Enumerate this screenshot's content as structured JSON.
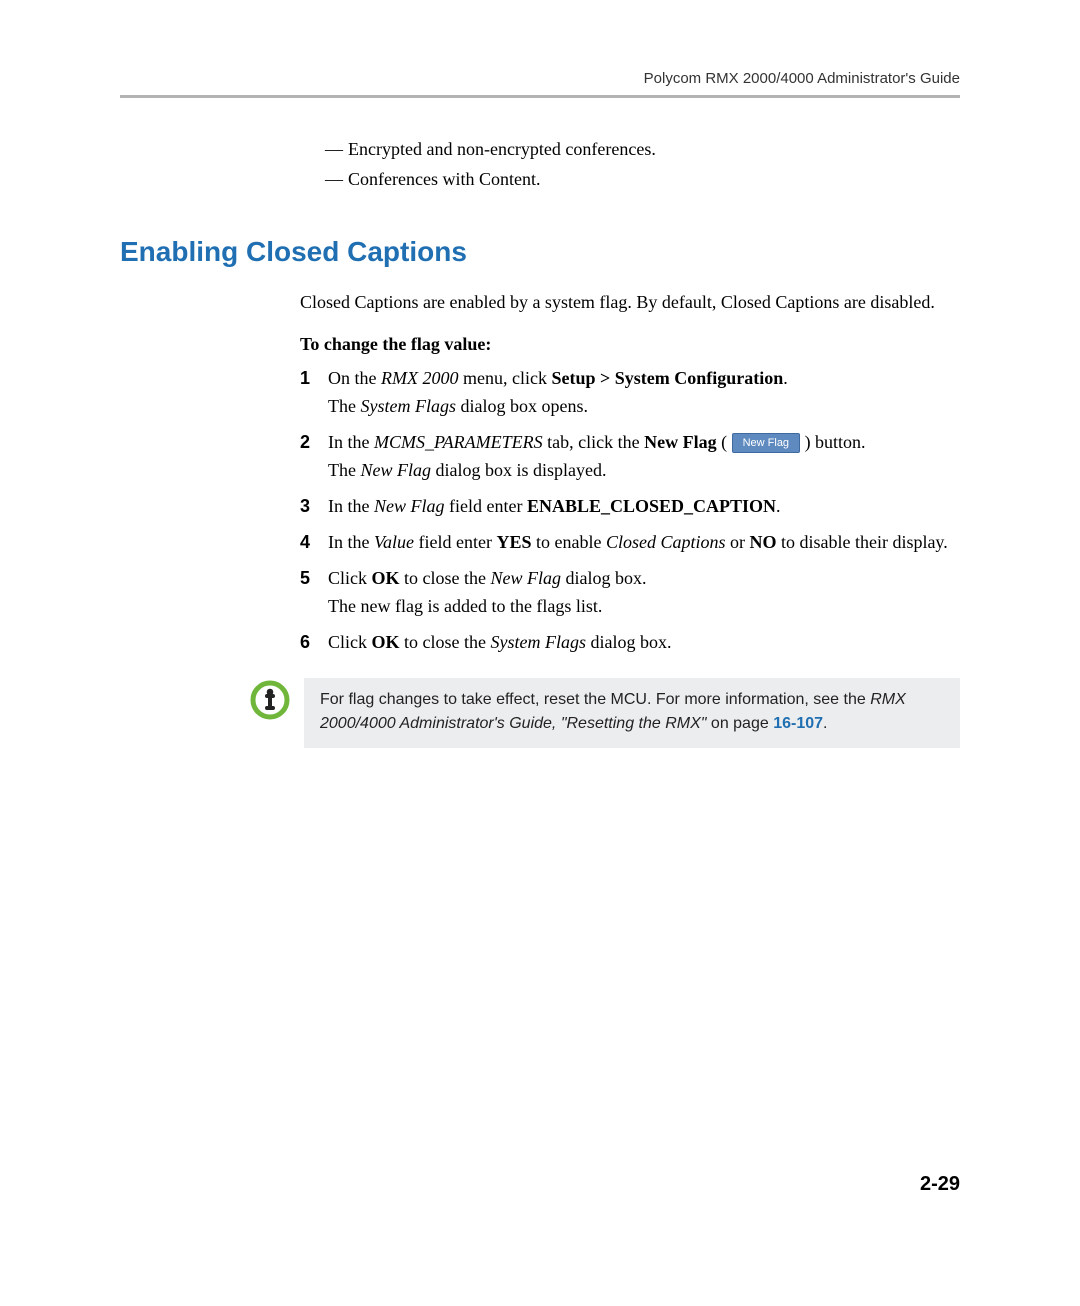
{
  "header": {
    "runningHead": "Polycom RMX 2000/4000 Administrator's Guide"
  },
  "bullets": [
    "Encrypted and non-encrypted conferences.",
    "Conferences with Content."
  ],
  "section": {
    "heading": "Enabling Closed Captions",
    "intro": "Closed Captions are enabled by a system flag. By default, Closed Captions are disabled.",
    "toChange": "To change the flag value:"
  },
  "steps": {
    "s1": {
      "num": "1",
      "prefix": "On the ",
      "italic1": "RMX 2000",
      "mid": " menu, click ",
      "bold1": "Setup > System Configuration",
      "end": ".",
      "line2a": "The ",
      "line2i": "System Flags",
      "line2b": " dialog box opens."
    },
    "s2": {
      "num": "2",
      "prefix": "In the ",
      "italic1": "MCMS_PARAMETERS",
      "mid": " tab, click the ",
      "bold1": "New Flag",
      "afterBold": " ( ",
      "btn": "New Flag",
      "afterBtn": " ) button.",
      "line2a": "The ",
      "line2i": "New Flag",
      "line2b": " dialog box is displayed."
    },
    "s3": {
      "num": "3",
      "prefix": "In the ",
      "italic1": "New Flag",
      "mid": " field enter ",
      "bold1": "ENABLE_CLOSED_CAPTION",
      "end": "."
    },
    "s4": {
      "num": "4",
      "prefix": "In the ",
      "italic1": "Value",
      "mid": " field enter ",
      "bold1": "YES",
      "mid2": " to enable ",
      "italic2": "Closed Captions",
      "mid3": " or ",
      "bold2": "NO",
      "end": " to disable their display."
    },
    "s5": {
      "num": "5",
      "prefix": "Click ",
      "bold1": "OK",
      "mid": " to close the ",
      "italic1": "New Flag",
      "end": " dialog box.",
      "line2": "The new flag is added to the flags list."
    },
    "s6": {
      "num": "6",
      "prefix": "Click ",
      "bold1": "OK",
      "mid": " to close the ",
      "italic1": "System Flags",
      "end": " dialog box."
    }
  },
  "note": {
    "line1": "For flag changes to take effect, reset the MCU. For more information, see the ",
    "italicRef": "RMX 2000/4000 Administrator's Guide, \"Resetting the RMX\"",
    "afterItalic": " on page ",
    "pageRef": "16-107",
    "period": "."
  },
  "pageNumber": "2-29"
}
